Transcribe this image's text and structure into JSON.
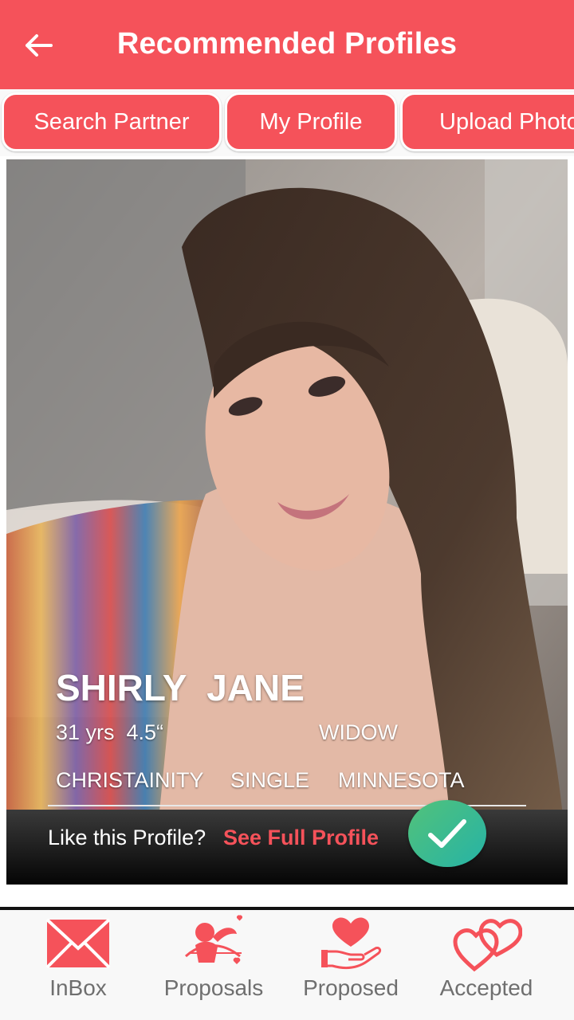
{
  "header": {
    "title": "Recommended Profiles",
    "back_icon": "arrow-back-icon"
  },
  "colors": {
    "accent": "#f5525a",
    "like_gradient": [
      "#52c27a",
      "#26b3a6"
    ]
  },
  "tabs": [
    {
      "label": "Search Partner"
    },
    {
      "label": "My Profile"
    },
    {
      "label": "Upload Photo"
    }
  ],
  "profile": {
    "name": "SHIRLY  JANE",
    "age_height": "31 yrs  4.5“",
    "marital": "WIDOW",
    "religion": "CHRISTAINITY",
    "status": "SINGLE",
    "location": "MINNESOTA",
    "like_question": "Like this Profile?",
    "full_profile_link": "See Full Profile",
    "like_icon": "checkmark-icon"
  },
  "nav": [
    {
      "label": "InBox",
      "icon": "envelope-icon"
    },
    {
      "label": "Proposals",
      "icon": "cupid-icon"
    },
    {
      "label": "Proposed",
      "icon": "heart-hand-icon"
    },
    {
      "label": "Accepted",
      "icon": "double-heart-icon"
    }
  ]
}
